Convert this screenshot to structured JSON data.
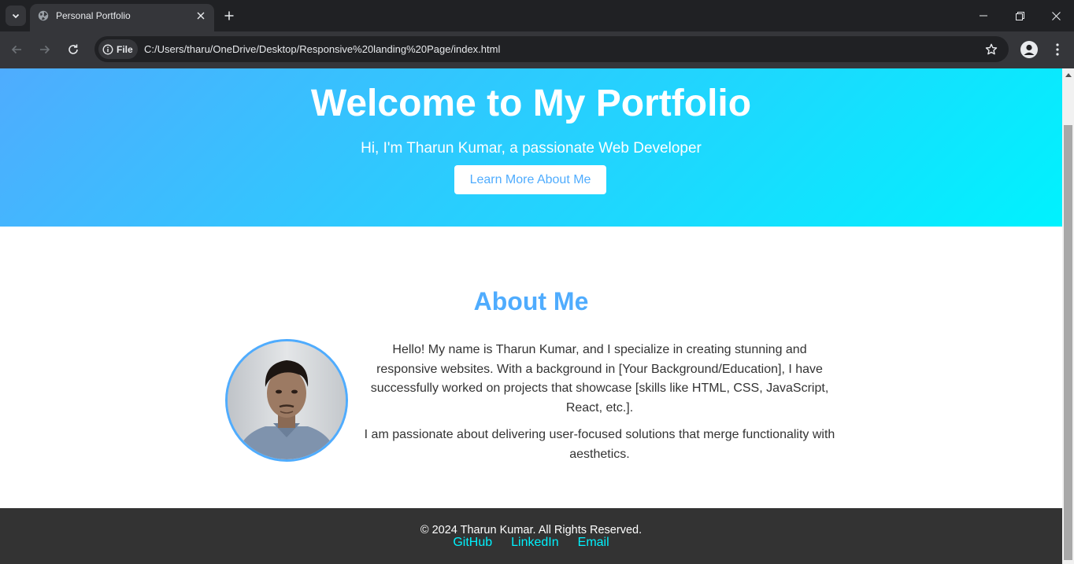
{
  "browser": {
    "tab": {
      "title": "Personal Portfolio",
      "favicon": "globe-icon"
    },
    "address_bar": {
      "site_chip_label": "File",
      "url": "C:/Users/tharu/OneDrive/Desktop/Responsive%20landing%20Page/index.html"
    }
  },
  "hero": {
    "title": "Welcome to My Portfolio",
    "subtitle": "Hi, I'm Tharun Kumar, a passionate Web Developer",
    "button_label": "Learn More About Me"
  },
  "about": {
    "title": "About Me",
    "paragraphs": [
      "Hello! My name is Tharun Kumar, and I specialize in creating stunning and responsive websites. With a background in [Your Background/Education], I have successfully worked on projects that showcase [skills like HTML, CSS, JavaScript, React, etc.].",
      "I am passionate about delivering user-focused solutions that merge functionality with aesthetics."
    ]
  },
  "footer": {
    "copyright": "© 2024 Tharun Kumar. All Rights Reserved.",
    "links": [
      "GitHub",
      "LinkedIn",
      "Email"
    ]
  },
  "colors": {
    "gradient_start": "#4facfe",
    "gradient_end": "#00f2fe",
    "footer_bg": "#333333",
    "footer_link": "#00f2fe"
  }
}
